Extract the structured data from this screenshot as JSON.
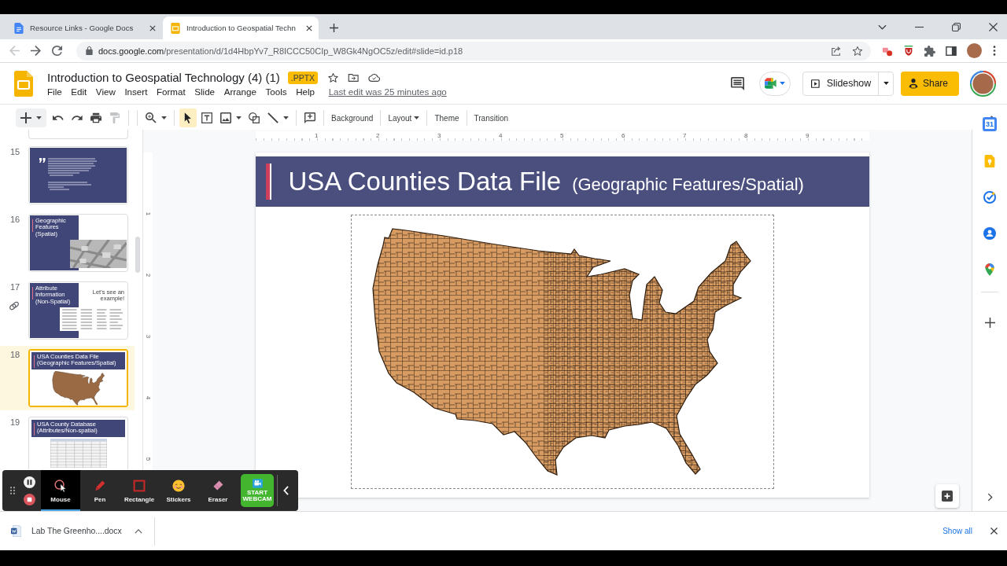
{
  "browser": {
    "tabs": [
      {
        "title": "Resource Links - Google Docs",
        "kind": "docs",
        "selected": false
      },
      {
        "title": "Introduction to Geospatial Techn",
        "kind": "slides",
        "selected": true
      }
    ],
    "back_disabled": true,
    "url_host": "docs.google.com",
    "url_path": "/presentation/d/1d4HbpYv7_R8ICCC50CIp_W8Gk4NgOC5z/edit#slide=id.p18"
  },
  "header": {
    "title": "Introduction to Geospatial Technology (4) (1)",
    "badge": ".PPTX",
    "menus": [
      "File",
      "Edit",
      "View",
      "Insert",
      "Format",
      "Slide",
      "Arrange",
      "Tools",
      "Help"
    ],
    "last_edit": "Last edit was 25 minutes ago",
    "slideshow": "Slideshow",
    "share": "Share"
  },
  "toolbar": {
    "actions": [
      {
        "kind": "new-slide",
        "dropdown": true,
        "disabled": false
      },
      {
        "kind": "undo",
        "dropdown": false,
        "disabled": false
      },
      {
        "kind": "redo",
        "dropdown": false,
        "disabled": false
      },
      {
        "kind": "print",
        "dropdown": false,
        "disabled": false
      },
      {
        "kind": "paint-format",
        "dropdown": false,
        "disabled": true
      },
      {
        "kind": "zoom",
        "dropdown": true,
        "disabled": false
      }
    ],
    "tools": [
      {
        "kind": "select",
        "dropdown": false,
        "selected": true
      },
      {
        "kind": "text-box",
        "dropdown": false,
        "selected": false
      },
      {
        "kind": "image",
        "dropdown": true,
        "selected": false
      },
      {
        "kind": "shape",
        "dropdown": false,
        "selected": false
      },
      {
        "kind": "line",
        "dropdown": true,
        "selected": false
      }
    ],
    "buttons": [
      {
        "label": "Background",
        "dropdown": false
      },
      {
        "label": "Layout",
        "dropdown": true
      },
      {
        "label": "Theme",
        "dropdown": false
      },
      {
        "label": "Transition",
        "dropdown": false
      }
    ]
  },
  "rulers": {
    "horizontal": [
      "1",
      "2",
      "3",
      "4",
      "5",
      "6",
      "7",
      "8",
      "9"
    ],
    "vertical": [
      "1",
      "2",
      "3",
      "4",
      "5"
    ]
  },
  "filmstrip": {
    "slides": [
      {
        "kind": "cut-off",
        "selected": false,
        "linked": false
      },
      {
        "number": "15",
        "kind": "quote",
        "selected": false,
        "linked": false
      },
      {
        "number": "16",
        "kind": "features",
        "title": "Geographic Features (Spatial)",
        "selected": false,
        "linked": false
      },
      {
        "number": "17",
        "kind": "attributes",
        "title": "Attribute Information (Non-Spatial)",
        "note": "Let's see an example!",
        "selected": false,
        "linked": true
      },
      {
        "number": "18",
        "kind": "map",
        "title": "USA Counties Data File",
        "subtitle": "(Geographic Features/Spatial)",
        "selected": true,
        "linked": false
      },
      {
        "number": "19",
        "kind": "table",
        "title": "USA County Database",
        "subtitle": "(Attributes/Non-spatial)",
        "selected": false,
        "linked": false
      }
    ]
  },
  "slide": {
    "title": "USA Counties Data File",
    "subtitle": "(Geographic Features/Spatial)"
  },
  "side_panel": {
    "calendar_day": "31"
  },
  "recorder": {
    "tools": [
      {
        "label": "Mouse",
        "kind": "mouse",
        "selected": true
      },
      {
        "label": "Pen",
        "kind": "pen",
        "selected": false
      },
      {
        "label": "Rectangle",
        "kind": "rectangle",
        "selected": false
      },
      {
        "label": "Stickers",
        "kind": "stickers",
        "selected": false
      },
      {
        "label": "Eraser",
        "kind": "eraser",
        "selected": false
      }
    ],
    "webcam": "START WEBCAM"
  },
  "downloads": {
    "file": "Lab The Greenho....docx",
    "show_all": "Show all"
  }
}
